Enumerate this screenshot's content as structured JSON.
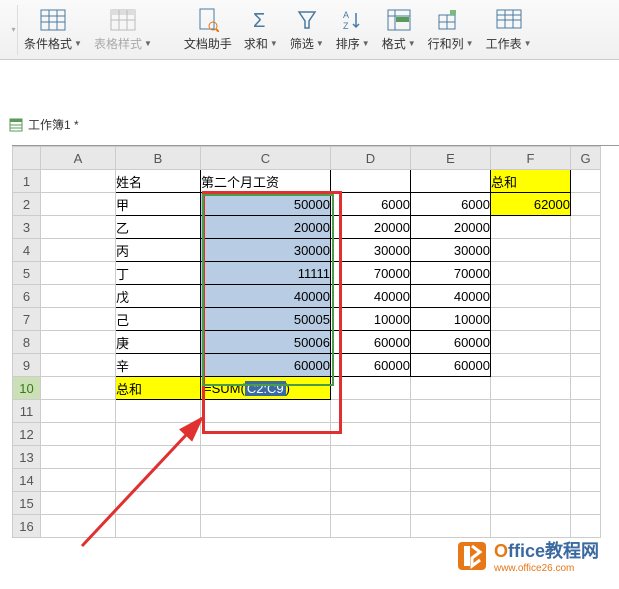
{
  "toolbar": {
    "conditional_format": "条件格式",
    "table_style": "表格样式",
    "doc_helper": "文档助手",
    "sum": "求和",
    "filter": "筛选",
    "sort": "排序",
    "format": "格式",
    "rows_cols": "行和列",
    "worksheet": "工作表"
  },
  "workbook": {
    "name": "工作簿1 *"
  },
  "columns": [
    "A",
    "B",
    "C",
    "D",
    "E",
    "F",
    "G"
  ],
  "rows": [
    "1",
    "2",
    "3",
    "4",
    "5",
    "6",
    "7",
    "8",
    "9",
    "10",
    "11",
    "12",
    "13",
    "14",
    "15",
    "16"
  ],
  "headers": {
    "name": "姓名",
    "second_month_salary": "第二个月工资",
    "total": "总和"
  },
  "data_rows": [
    {
      "name": "甲",
      "c": "50000",
      "d": "6000",
      "e": "6000",
      "f": "62000"
    },
    {
      "name": "乙",
      "c": "20000",
      "d": "20000",
      "e": "20000"
    },
    {
      "name": "丙",
      "c": "30000",
      "d": "30000",
      "e": "30000"
    },
    {
      "name": "丁",
      "c": "11111",
      "d": "70000",
      "e": "70000"
    },
    {
      "name": "戊",
      "c": "40000",
      "d": "40000",
      "e": "40000"
    },
    {
      "name": "己",
      "c": "50005",
      "d": "10000",
      "e": "10000"
    },
    {
      "name": "庚",
      "c": "50006",
      "d": "60000",
      "e": "60000"
    },
    {
      "name": "辛",
      "c": "60000",
      "d": "60000",
      "e": "60000"
    }
  ],
  "sum_row": {
    "label": "总和",
    "formula_prefix": "=SUM(",
    "formula_ref": "C2:C9",
    "formula_suffix": ")"
  },
  "watermark": {
    "title_accent": "O",
    "title_rest": "ffice教程网",
    "url": "www.office26.com"
  }
}
